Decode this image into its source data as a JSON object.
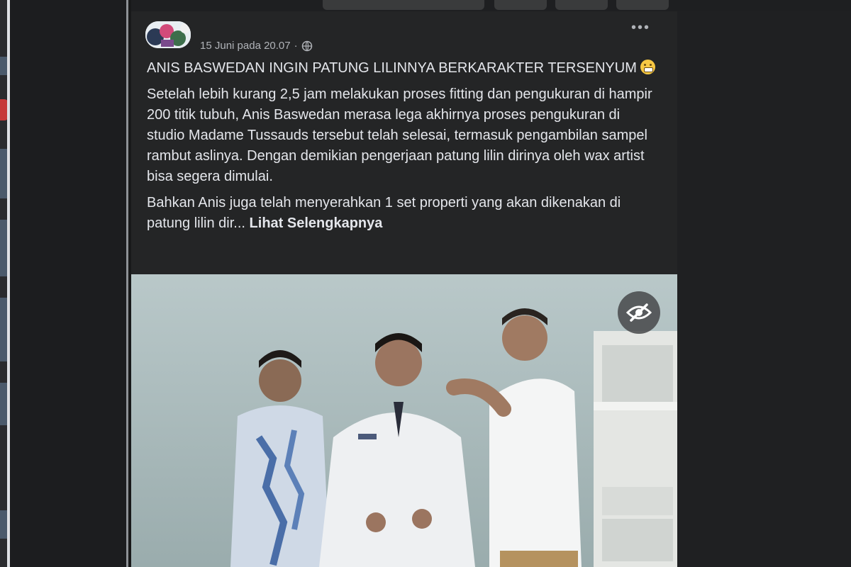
{
  "post": {
    "timestamp": "15 Juni pada 20.07",
    "separator": "·",
    "privacy_icon": "globe-icon",
    "more_icon": "more-options-icon",
    "title": "ANIS BASWEDAN INGIN PATUNG LILINNYA BERKARAKTER TERSENYUM",
    "title_emoji": "grimacing-face-emoji",
    "paragraph_1": "Setelah lebih kurang 2,5 jam melakukan proses fitting dan pengukuran di hampir 200 titik tubuh, Anis Baswedan merasa lega akhirnya proses pengukuran di studio Madame Tussauds tersebut telah selesai, termasuk pengambilan sampel rambut aslinya. Dengan demikian pengerjaan patung lilin dirinya oleh wax artist bisa segera dimulai.",
    "paragraph_2": "Bahkan Anis juga telah menyerahkan 1 set properti yang akan dikenakan di patung lilin dir...",
    "see_more": "Lihat Selengkapnya",
    "photo_overlay_icon": "eye-slash-icon"
  },
  "colors": {
    "page_bg": "#18191a",
    "card_bg": "#242526",
    "text_primary": "#e4e6eb",
    "text_secondary": "#b0b3b8"
  }
}
